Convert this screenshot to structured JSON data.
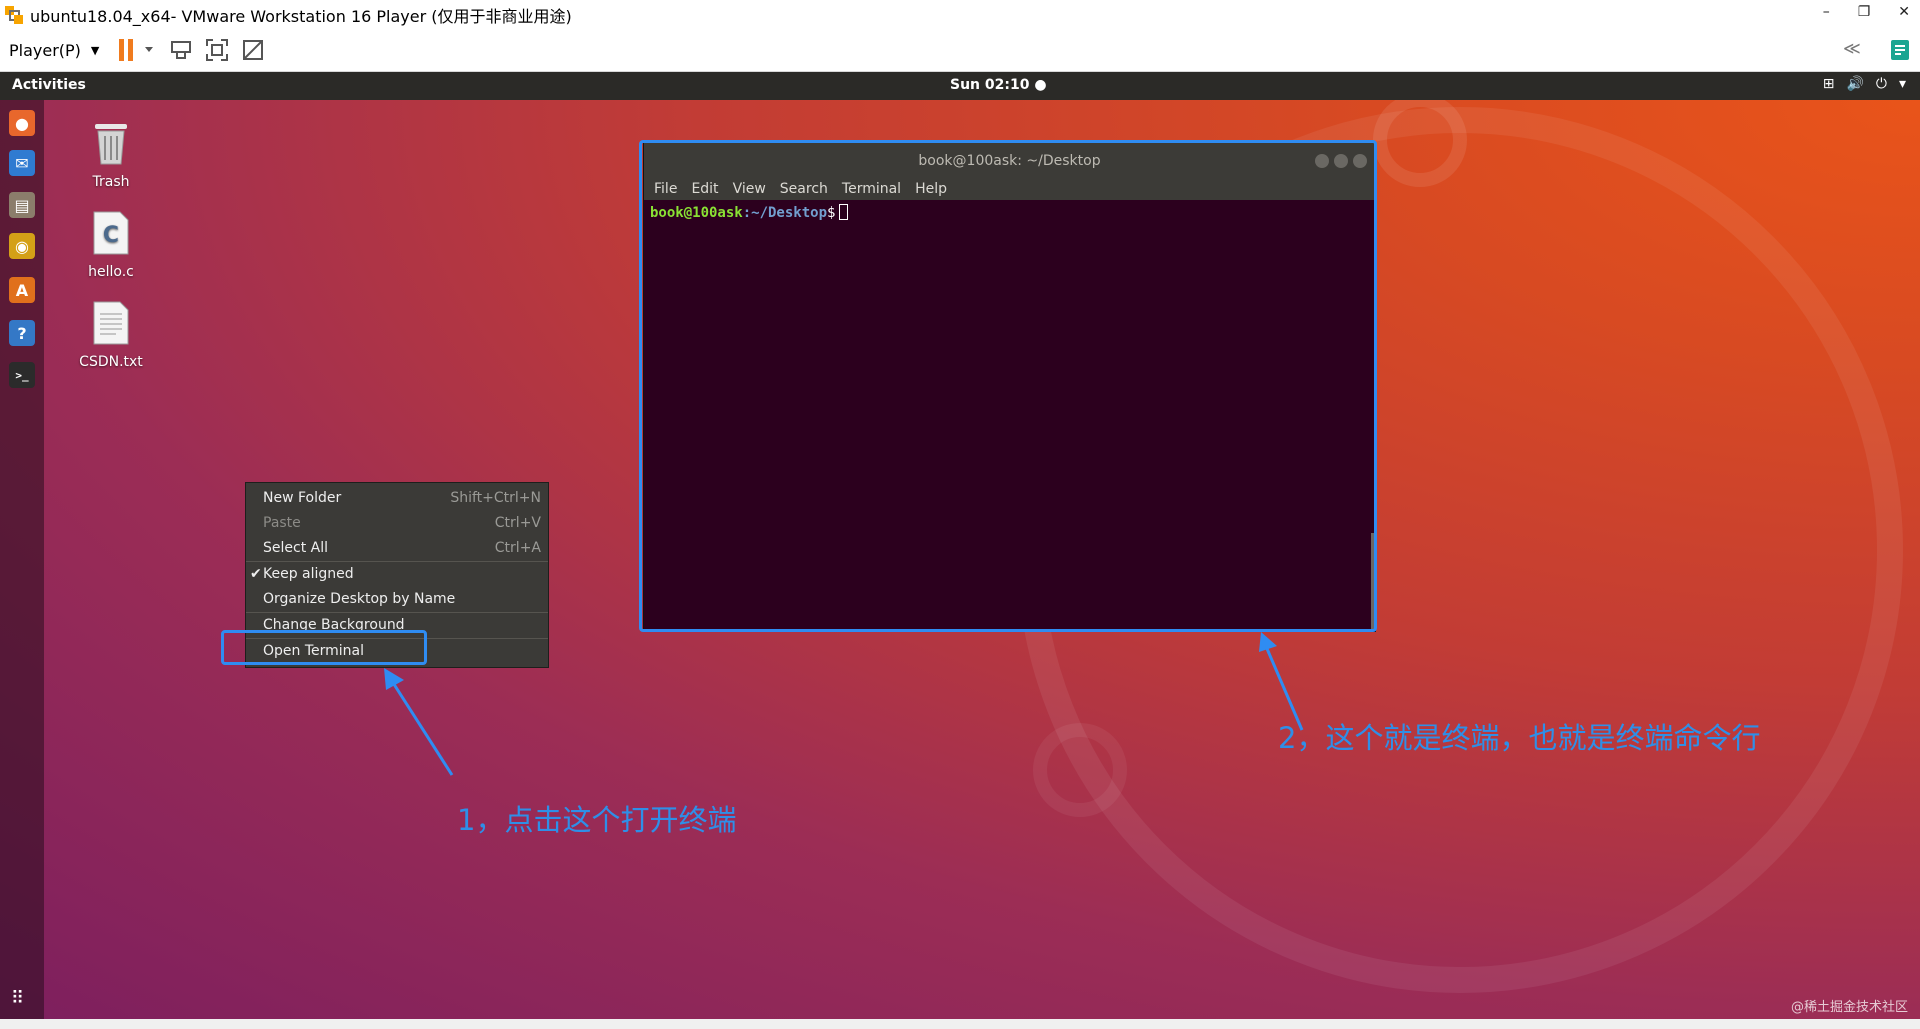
{
  "vm": {
    "title": "ubuntu18.04_x64- VMware Workstation 16 Player (仅用于非商业用途)",
    "player_menu": "Player(P)",
    "minimize": "–",
    "restore": "❐",
    "close": "✕"
  },
  "ubuntu": {
    "activities": "Activities",
    "clock": "Sun 02:10 ●",
    "tray": {
      "network": "⊞",
      "volume": "🔊",
      "power": "⏻",
      "arrow": "▾"
    }
  },
  "dock": [
    {
      "name": "firefox-icon",
      "glyph": "●",
      "color": "#e8672c"
    },
    {
      "name": "thunderbird-icon",
      "glyph": "✉",
      "color": "#2f7bd1"
    },
    {
      "name": "files-icon",
      "glyph": "▤",
      "color": "#8b7d6b"
    },
    {
      "name": "rhythmbox-icon",
      "glyph": "◉",
      "color": "#d4a017"
    },
    {
      "name": "software-icon",
      "glyph": "A",
      "color": "#e0701c"
    },
    {
      "name": "help-icon",
      "glyph": "?",
      "color": "#3478c6"
    },
    {
      "name": "terminal-icon",
      "glyph": ">_",
      "color": "#2b2b2b"
    }
  ],
  "desktop_icons": {
    "trash": "Trash",
    "hello": "hello.c",
    "csdn": "CSDN.txt"
  },
  "context_menu": {
    "new_folder": "New Folder",
    "new_folder_acc": "Shift+Ctrl+N",
    "paste": "Paste",
    "paste_acc": "Ctrl+V",
    "select_all": "Select All",
    "select_all_acc": "Ctrl+A",
    "keep_aligned": "Keep aligned",
    "organize": "Organize Desktop by Name",
    "change_bg": "Change Background",
    "open_terminal": "Open Terminal"
  },
  "terminal": {
    "title": "book@100ask: ~/Desktop",
    "menu": [
      "File",
      "Edit",
      "View",
      "Search",
      "Terminal",
      "Help"
    ],
    "prompt_user": "book@100ask",
    "prompt_path": ":~/Desktop",
    "prompt_end": "$"
  },
  "annotations": {
    "one": "1，点击这个打开终端",
    "two": "2，这个就是终端，也就是终端命令行"
  },
  "watermark": "@稀土掘金技术社区"
}
